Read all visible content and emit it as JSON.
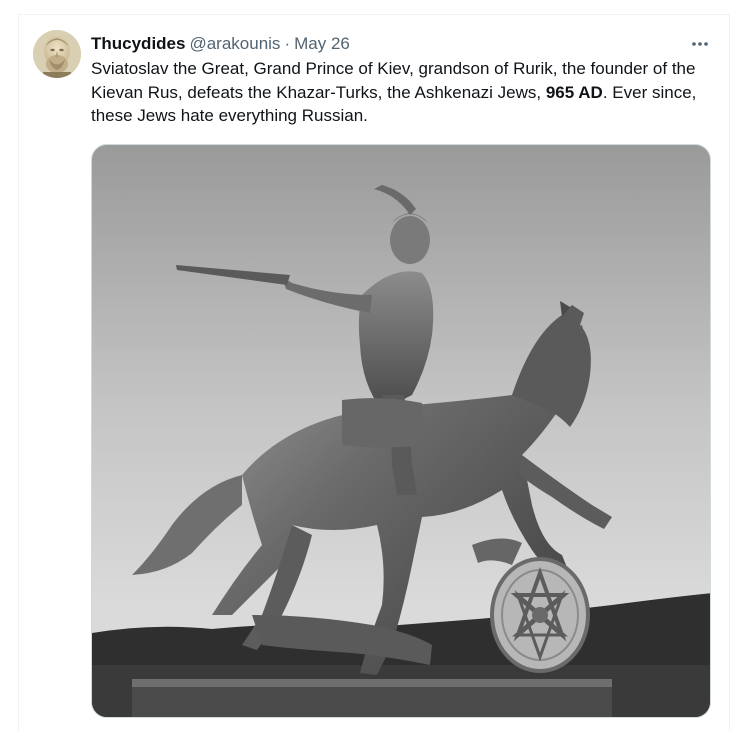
{
  "tweet": {
    "author_name": "Thucydides",
    "author_handle": "@arakounis",
    "separator": "·",
    "date": "May 26",
    "more_icon": "more-horizontal-icon",
    "text_part1": "Sviatoslav the Great, Grand Prince of Kiev, grandson of Rurik, the founder of the Kievan Rus, defeats the Khazar-Turks, the Ashkenazi Jews, ",
    "text_bold": "965 AD",
    "text_part2": ". Ever since, these Jews hate everything Russian."
  },
  "colors": {
    "text_primary": "#0f1419",
    "text_secondary": "#536471",
    "border": "#eff3f4"
  }
}
